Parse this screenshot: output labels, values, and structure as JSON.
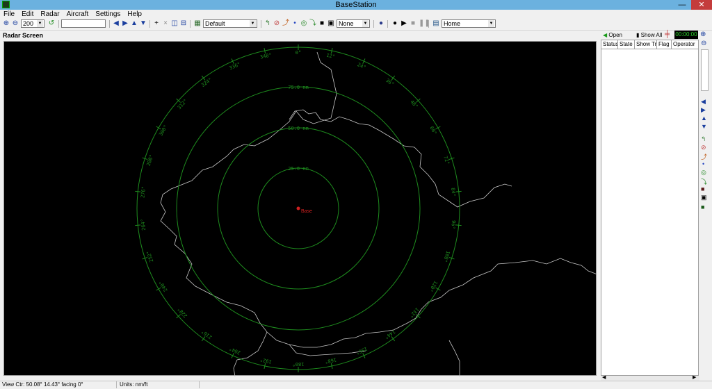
{
  "window": {
    "title": "BaseStation",
    "minimize": "—",
    "maximize": "☐",
    "close": "✕"
  },
  "menu": [
    "File",
    "Edit",
    "Radar",
    "Aircraft",
    "Settings",
    "Help"
  ],
  "toolbar": {
    "range_value": "200",
    "layout_value": "Default",
    "overlay_value": "None",
    "location_value": "Home"
  },
  "radar": {
    "label": "Radar Screen",
    "base_label": "Base",
    "range_labels": [
      "25.0 nm",
      "50.0 nm",
      "75.0 nm"
    ],
    "bearings": [
      "0°",
      "12°",
      "24°",
      "36°",
      "48°",
      "60°",
      "72°",
      "84°",
      "96°",
      "108°",
      "120°",
      "132°",
      "144°",
      "156°",
      "168°",
      "180°",
      "192°",
      "204°",
      "216°",
      "228°",
      "240°",
      "252°",
      "264°",
      "276°",
      "288°",
      "300°",
      "312°",
      "324°",
      "336°",
      "348°"
    ],
    "ring_color": "#1e8c1e",
    "coast_color": "#c8c8c8",
    "base_color": "#d02020"
  },
  "right_panel": {
    "open_label": "Open",
    "show_all_label": "Show All",
    "timer": "00:00:00",
    "columns": [
      "Status",
      "State",
      "Show Trail",
      "Flag",
      "Operator"
    ]
  },
  "status": {
    "view_center": "View Ctr: 50.08° 14.43° facing 0°",
    "units": "Units: nm/ft"
  }
}
